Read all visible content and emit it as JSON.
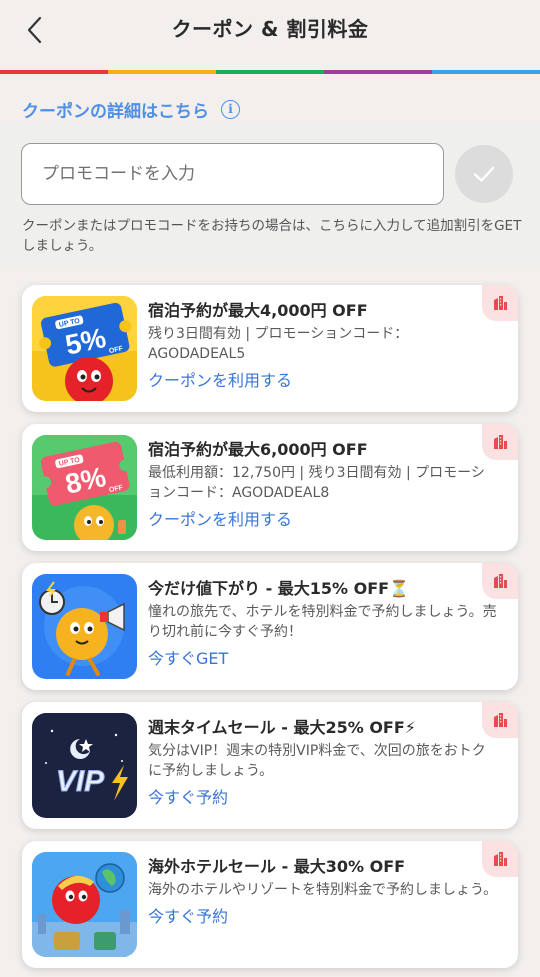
{
  "header": {
    "title": "クーポン & 割引料金"
  },
  "rainbow_colors": [
    "#e8383c",
    "#f7b016",
    "#1cab56",
    "#a13d9c",
    "#3c9fe8"
  ],
  "details_link": {
    "label": "クーポンの詳細はこちら",
    "icon": "info-icon"
  },
  "promo": {
    "placeholder": "プロモコードを入力",
    "value": "",
    "hint": "クーポンまたはプロモコードをお持ちの場合は、こちらに入力して追加割引をGETしましょう。",
    "submit_icon": "check-icon"
  },
  "cards": [
    {
      "title": "宿泊予約が最大4,000円 OFF",
      "desc": "残り3日間有効 | プロモーションコード：AGODADEAL5",
      "cta": "クーポンを利用する",
      "badge_percent": "5%",
      "badge_top": "UP TO",
      "badge_off": "OFF"
    },
    {
      "title": "宿泊予約が最大6,000円 OFF",
      "desc": "最低利用額：12,750円 | 残り3日間有効 | プロモーションコード：AGODADEAL8",
      "cta": "クーポンを利用する",
      "badge_percent": "8%",
      "badge_top": "UP TO",
      "badge_off": "OFF"
    },
    {
      "title": "今だけ値下がり - 最大15% OFF⏳",
      "desc": "憧れの旅先で、ホテルを特別料金で予約しましょう。売り切れ前に今すぐ予約！",
      "cta": "今すぐGET"
    },
    {
      "title": "週末タイムセール - 最大25% OFF⚡",
      "desc": "気分はVIP！週末の特別VIP料金で、次回の旅をおトクに予約しましょう。",
      "cta": "今すぐ予約",
      "badge_text": "VIP"
    },
    {
      "title": "海外ホテルセール - 最大30% OFF",
      "desc": "海外のホテルやリゾートを特別料金で予約しましょう。",
      "cta": "今すぐ予約"
    }
  ]
}
